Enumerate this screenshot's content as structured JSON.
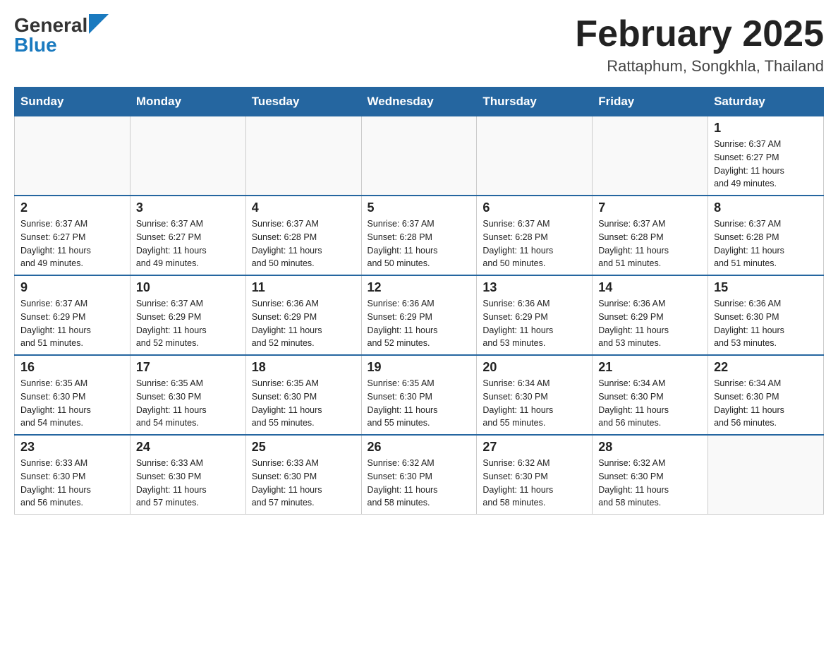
{
  "header": {
    "logo_general": "General",
    "logo_blue": "Blue",
    "month_title": "February 2025",
    "location": "Rattaphum, Songkhla, Thailand"
  },
  "days_of_week": [
    "Sunday",
    "Monday",
    "Tuesday",
    "Wednesday",
    "Thursday",
    "Friday",
    "Saturday"
  ],
  "weeks": [
    [
      {
        "day": "",
        "info": ""
      },
      {
        "day": "",
        "info": ""
      },
      {
        "day": "",
        "info": ""
      },
      {
        "day": "",
        "info": ""
      },
      {
        "day": "",
        "info": ""
      },
      {
        "day": "",
        "info": ""
      },
      {
        "day": "1",
        "info": "Sunrise: 6:37 AM\nSunset: 6:27 PM\nDaylight: 11 hours\nand 49 minutes."
      }
    ],
    [
      {
        "day": "2",
        "info": "Sunrise: 6:37 AM\nSunset: 6:27 PM\nDaylight: 11 hours\nand 49 minutes."
      },
      {
        "day": "3",
        "info": "Sunrise: 6:37 AM\nSunset: 6:27 PM\nDaylight: 11 hours\nand 49 minutes."
      },
      {
        "day": "4",
        "info": "Sunrise: 6:37 AM\nSunset: 6:28 PM\nDaylight: 11 hours\nand 50 minutes."
      },
      {
        "day": "5",
        "info": "Sunrise: 6:37 AM\nSunset: 6:28 PM\nDaylight: 11 hours\nand 50 minutes."
      },
      {
        "day": "6",
        "info": "Sunrise: 6:37 AM\nSunset: 6:28 PM\nDaylight: 11 hours\nand 50 minutes."
      },
      {
        "day": "7",
        "info": "Sunrise: 6:37 AM\nSunset: 6:28 PM\nDaylight: 11 hours\nand 51 minutes."
      },
      {
        "day": "8",
        "info": "Sunrise: 6:37 AM\nSunset: 6:28 PM\nDaylight: 11 hours\nand 51 minutes."
      }
    ],
    [
      {
        "day": "9",
        "info": "Sunrise: 6:37 AM\nSunset: 6:29 PM\nDaylight: 11 hours\nand 51 minutes."
      },
      {
        "day": "10",
        "info": "Sunrise: 6:37 AM\nSunset: 6:29 PM\nDaylight: 11 hours\nand 52 minutes."
      },
      {
        "day": "11",
        "info": "Sunrise: 6:36 AM\nSunset: 6:29 PM\nDaylight: 11 hours\nand 52 minutes."
      },
      {
        "day": "12",
        "info": "Sunrise: 6:36 AM\nSunset: 6:29 PM\nDaylight: 11 hours\nand 52 minutes."
      },
      {
        "day": "13",
        "info": "Sunrise: 6:36 AM\nSunset: 6:29 PM\nDaylight: 11 hours\nand 53 minutes."
      },
      {
        "day": "14",
        "info": "Sunrise: 6:36 AM\nSunset: 6:29 PM\nDaylight: 11 hours\nand 53 minutes."
      },
      {
        "day": "15",
        "info": "Sunrise: 6:36 AM\nSunset: 6:30 PM\nDaylight: 11 hours\nand 53 minutes."
      }
    ],
    [
      {
        "day": "16",
        "info": "Sunrise: 6:35 AM\nSunset: 6:30 PM\nDaylight: 11 hours\nand 54 minutes."
      },
      {
        "day": "17",
        "info": "Sunrise: 6:35 AM\nSunset: 6:30 PM\nDaylight: 11 hours\nand 54 minutes."
      },
      {
        "day": "18",
        "info": "Sunrise: 6:35 AM\nSunset: 6:30 PM\nDaylight: 11 hours\nand 55 minutes."
      },
      {
        "day": "19",
        "info": "Sunrise: 6:35 AM\nSunset: 6:30 PM\nDaylight: 11 hours\nand 55 minutes."
      },
      {
        "day": "20",
        "info": "Sunrise: 6:34 AM\nSunset: 6:30 PM\nDaylight: 11 hours\nand 55 minutes."
      },
      {
        "day": "21",
        "info": "Sunrise: 6:34 AM\nSunset: 6:30 PM\nDaylight: 11 hours\nand 56 minutes."
      },
      {
        "day": "22",
        "info": "Sunrise: 6:34 AM\nSunset: 6:30 PM\nDaylight: 11 hours\nand 56 minutes."
      }
    ],
    [
      {
        "day": "23",
        "info": "Sunrise: 6:33 AM\nSunset: 6:30 PM\nDaylight: 11 hours\nand 56 minutes."
      },
      {
        "day": "24",
        "info": "Sunrise: 6:33 AM\nSunset: 6:30 PM\nDaylight: 11 hours\nand 57 minutes."
      },
      {
        "day": "25",
        "info": "Sunrise: 6:33 AM\nSunset: 6:30 PM\nDaylight: 11 hours\nand 57 minutes."
      },
      {
        "day": "26",
        "info": "Sunrise: 6:32 AM\nSunset: 6:30 PM\nDaylight: 11 hours\nand 58 minutes."
      },
      {
        "day": "27",
        "info": "Sunrise: 6:32 AM\nSunset: 6:30 PM\nDaylight: 11 hours\nand 58 minutes."
      },
      {
        "day": "28",
        "info": "Sunrise: 6:32 AM\nSunset: 6:30 PM\nDaylight: 11 hours\nand 58 minutes."
      },
      {
        "day": "",
        "info": ""
      }
    ]
  ]
}
